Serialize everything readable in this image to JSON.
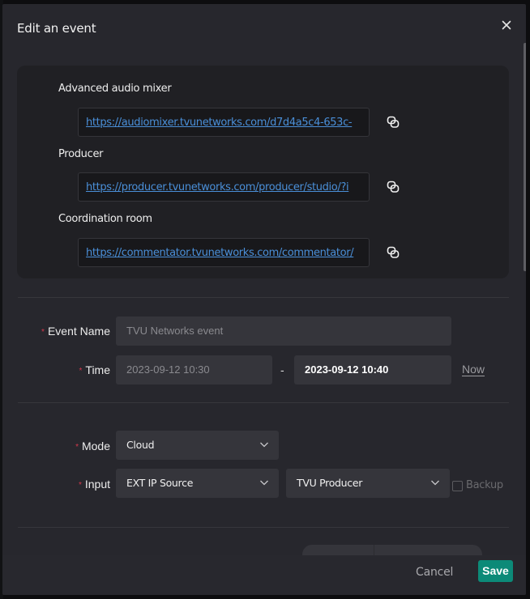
{
  "modal": {
    "title": "Edit an event",
    "close_icon": "close-icon"
  },
  "links": [
    {
      "label": "Advanced audio mixer",
      "url": "https://audiomixer.tvunetworks.com/d7d4a5c4-653c-",
      "copy_icon": "copy-link-icon"
    },
    {
      "label": "Producer",
      "url": "https://producer.tvunetworks.com/producer/studio/?i",
      "copy_icon": "copy-link-icon"
    },
    {
      "label": "Coordination room",
      "url": "https://commentator.tvunetworks.com/commentator/",
      "copy_icon": "copy-link-icon"
    }
  ],
  "form": {
    "required_mark": "*",
    "event_name": {
      "label": "Event Name",
      "placeholder": "TVU Networks event"
    },
    "time": {
      "label": "Time",
      "start_placeholder": "2023-09-12 10:30",
      "separator": "-",
      "end_value": "2023-09-12 10:40",
      "now_label": "Now"
    },
    "mode": {
      "label": "Mode",
      "selected": "Cloud"
    },
    "input": {
      "label": "Input",
      "source_selected": "EXT IP Source",
      "device_selected": "TVU Producer",
      "backup_label": "Backup",
      "backup_checked": false
    }
  },
  "footer": {
    "cancel_label": "Cancel",
    "save_label": "Save"
  },
  "colors": {
    "accent": "#0c8a78",
    "link": "#4a8fd8",
    "required": "#d4384c",
    "modal_bg": "#27272d"
  }
}
